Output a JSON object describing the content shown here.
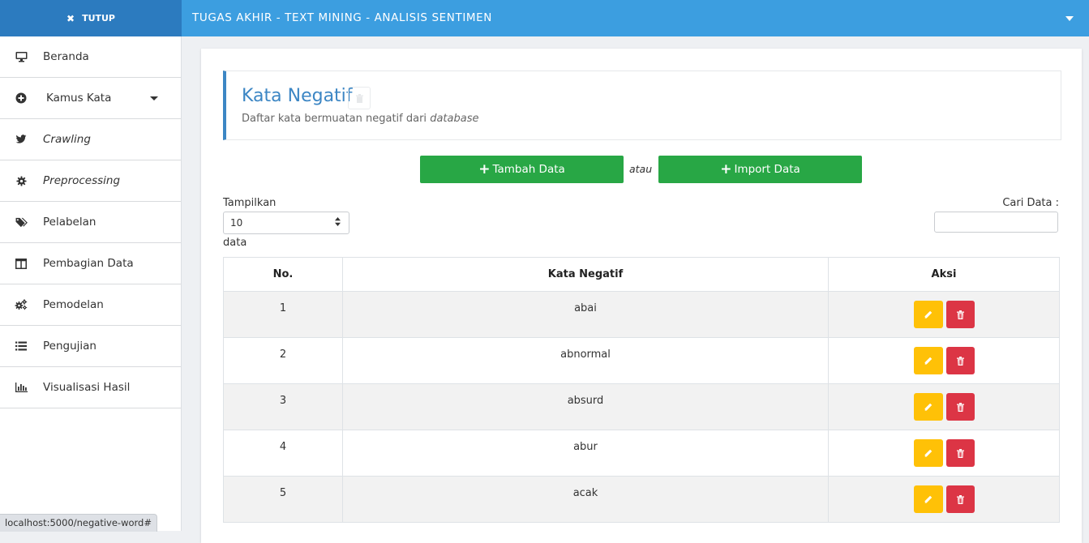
{
  "topbar": {
    "close_label": "TUTUP",
    "app_title": "TUGAS AKHIR - TEXT MINING - ANALISIS SENTIMEN"
  },
  "sidebar": {
    "items": [
      {
        "label": "Beranda",
        "icon": "monitor-icon"
      },
      {
        "label": "Kamus Kata",
        "icon": "plus-circle-icon"
      },
      {
        "label": "Crawling",
        "icon": "twitter-icon"
      },
      {
        "label": "Preprocessing",
        "icon": "gear-icon"
      },
      {
        "label": "Pelabelan",
        "icon": "tags-icon"
      },
      {
        "label": "Pembagian Data",
        "icon": "columns-icon"
      },
      {
        "label": "Pemodelan",
        "icon": "cogs-icon"
      },
      {
        "label": "Pengujian",
        "icon": "list-icon"
      },
      {
        "label": "Visualisasi Hasil",
        "icon": "bar-chart-icon"
      }
    ]
  },
  "header": {
    "title": "Kata Negatif",
    "subtitle_prefix": "Daftar kata bermuatan negatif dari ",
    "subtitle_em": "database"
  },
  "actions": {
    "add_label": "Tambah Data",
    "or_text": "atau",
    "import_label": "Import Data"
  },
  "controls": {
    "show_label": "Tampilkan",
    "page_size": "10",
    "show_suffix": "data",
    "search_label": "Cari Data :",
    "search_value": ""
  },
  "table": {
    "headers": [
      "No.",
      "Kata Negatif",
      "Aksi"
    ],
    "rows": [
      {
        "no": "1",
        "word": "abai"
      },
      {
        "no": "2",
        "word": "abnormal"
      },
      {
        "no": "3",
        "word": "absurd"
      },
      {
        "no": "4",
        "word": "abur"
      },
      {
        "no": "5",
        "word": "acak"
      }
    ]
  },
  "status_url": "localhost:5000/negative-word#",
  "colors": {
    "topbar": "#3c9ee0",
    "close_button": "#2c7bbf",
    "title": "#3c86c4",
    "success": "#28a745",
    "warning": "#ffc107",
    "danger": "#dc3545"
  }
}
